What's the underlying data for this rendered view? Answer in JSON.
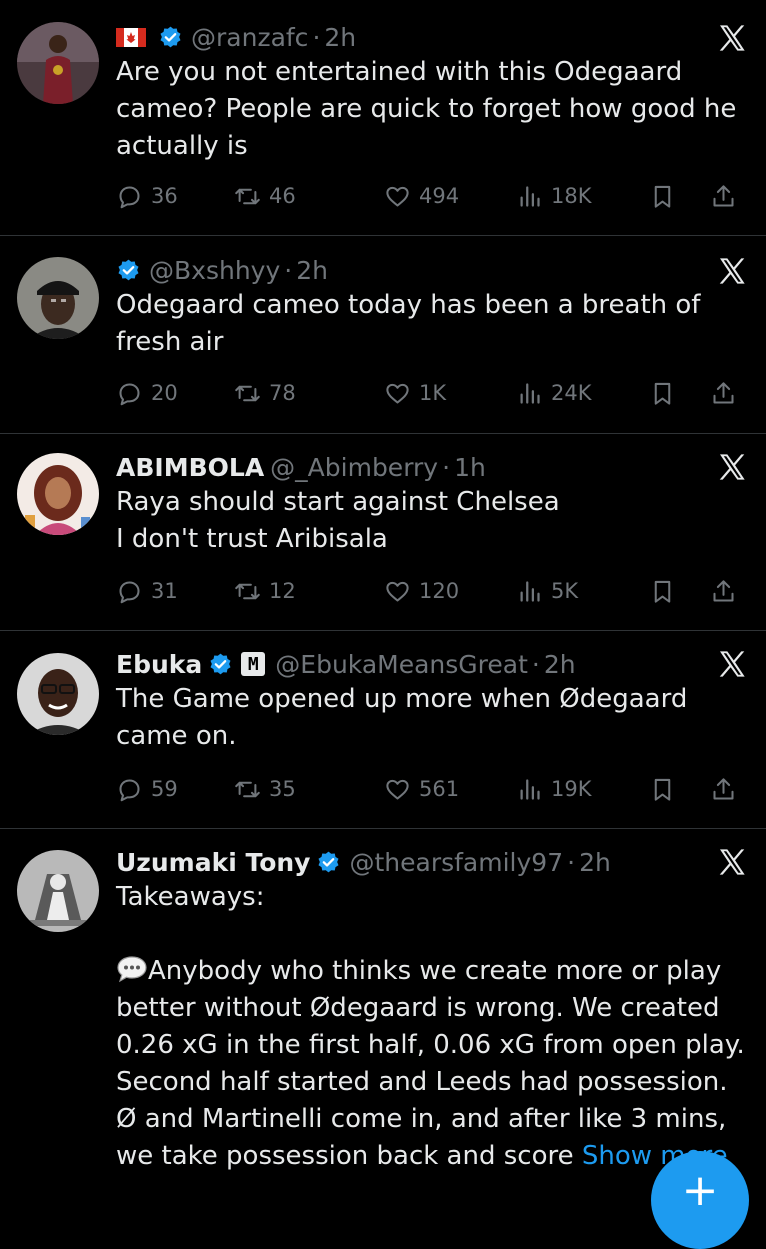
{
  "tweets": [
    {
      "username": "",
      "handle": "@ranzafc",
      "time": "2h",
      "has_flag": true,
      "text": "Are you not entertained with this Odegaard cameo? People are quick to forget how good he actually is",
      "stats": {
        "replies": "36",
        "retweets": "46",
        "likes": "494",
        "views": "18K"
      }
    },
    {
      "username": "",
      "handle": "@Bxshhyy",
      "time": "2h",
      "text": "Odegaard cameo today has been a breath of fresh air",
      "stats": {
        "replies": "20",
        "retweets": "78",
        "likes": "1K",
        "views": "24K"
      }
    },
    {
      "username": "ABIMBOLA",
      "handle": "@_Abimberry",
      "time": "1h",
      "text": "Raya should start against Chelsea\nI don't trust Aribisala",
      "stats": {
        "replies": "31",
        "retweets": "12",
        "likes": "120",
        "views": "5K"
      }
    },
    {
      "username": "Ebuka",
      "badge": "M",
      "handle": "@EbukaMeansGreat",
      "time": "2h",
      "text": "The Game opened up more when Ødegaard came on.",
      "stats": {
        "replies": "59",
        "retweets": "35",
        "likes": "561",
        "views": "19K"
      }
    },
    {
      "username": "Uzumaki Tony",
      "handle": "@thearsfamily97",
      "time": "2h",
      "text_intro": "Takeaways:\n\n",
      "text_body": "Anybody who thinks we create more or play better without Ødegaard is wrong. We created 0.26 xG in the first half, 0.06 xG from open play. Second half started and Leeds had possession. Ø and Martinelli come in, and after like 3 mins, we take possession back and score ",
      "show_more": "Show more"
    }
  ],
  "dot": "·",
  "compose_button": "+",
  "colors": {
    "background": "#000000",
    "text": "#e7e9ea",
    "secondary": "#71767b",
    "accent": "#1d9bf0"
  }
}
